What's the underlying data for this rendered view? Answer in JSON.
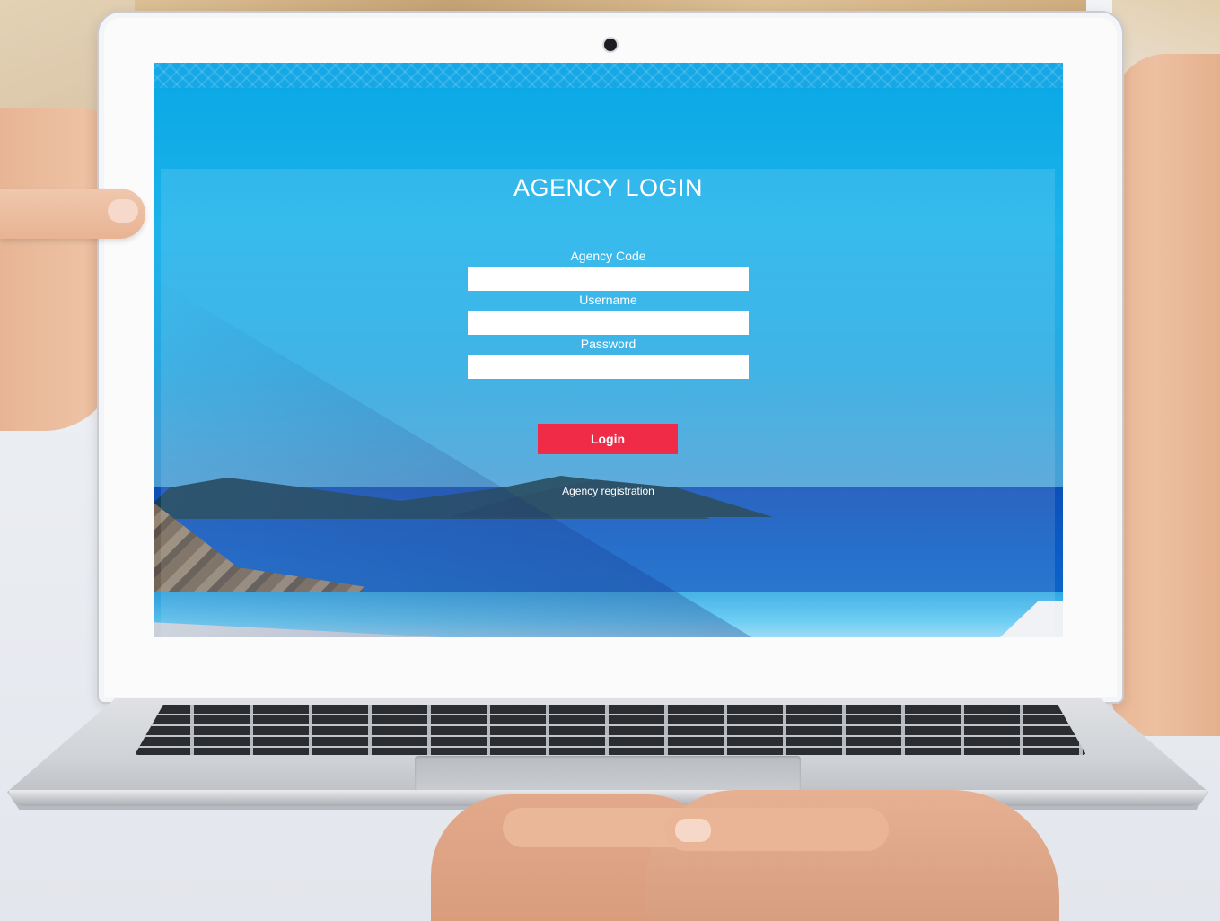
{
  "login": {
    "title": "AGENCY LOGIN",
    "agency_code_label": "Agency Code",
    "agency_code_value": "",
    "username_label": "Username",
    "username_value": "",
    "password_label": "Password",
    "password_value": "",
    "login_button": "Login",
    "registration_link": "Agency registration"
  },
  "colors": {
    "screen_blue": "#0ba8e6",
    "login_button": "#ef2b48",
    "text": "#ffffff"
  }
}
